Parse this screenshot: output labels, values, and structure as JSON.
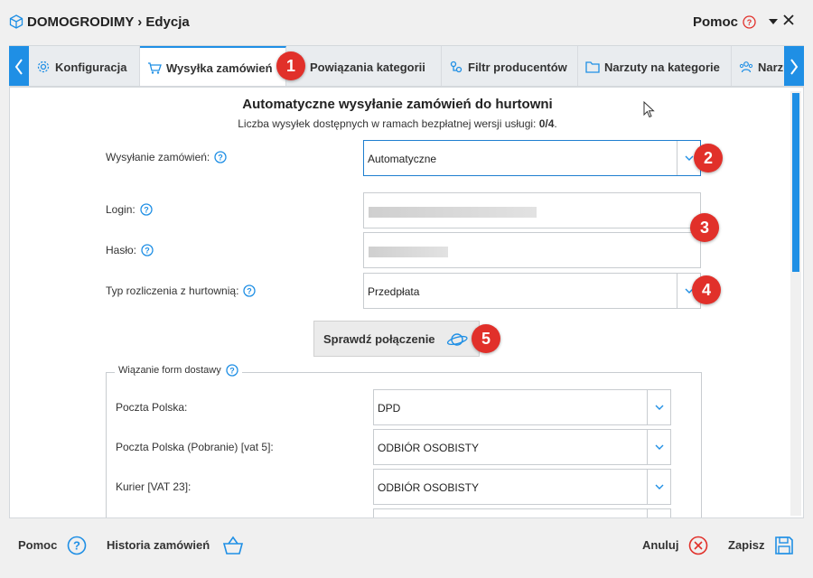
{
  "window": {
    "title": "DOMOGRODIMY › Edycja",
    "help_label": "Pomoc"
  },
  "tabs": [
    {
      "label": "Konfiguracja",
      "icon": "gear-icon"
    },
    {
      "label": "Wysyłka zamówień",
      "icon": "cart-icon",
      "active": true
    },
    {
      "label": "Powiązania kategorii",
      "icon": "link-icon"
    },
    {
      "label": "Filtr producentów",
      "icon": "filter-icon"
    },
    {
      "label": "Narzuty na kategorie",
      "icon": "folder-icon"
    },
    {
      "label": "Narzu",
      "icon": "users-icon"
    }
  ],
  "main": {
    "heading": "Automatyczne wysyłanie zamówień do hurtowni",
    "subheading_text": "Liczba wysyłek dostępnych w ramach bezpłatnej wersji usługi: ",
    "subheading_value": "0/4",
    "subheading_end": ".",
    "fields": {
      "order_sending": {
        "label": "Wysyłanie zamówień:",
        "value": "Automatyczne"
      },
      "login": {
        "label": "Login:"
      },
      "password": {
        "label": "Hasło:"
      },
      "billing_type": {
        "label": "Typ rozliczenia z hurtownią:",
        "value": "Przedpłata"
      }
    },
    "check_button": "Sprawdź połączenie",
    "shipping_mapping": {
      "legend": "Wiązanie form dostawy",
      "rows": [
        {
          "label": "Poczta Polska:",
          "value": "DPD"
        },
        {
          "label": "Poczta Polska (Pobranie) [vat 5]:",
          "value": "ODBIÓR OSOBISTY"
        },
        {
          "label": "Kurier [VAT 23]:",
          "value": "ODBIÓR OSOBISTY"
        }
      ]
    }
  },
  "badges": [
    "1",
    "2",
    "3",
    "4",
    "5"
  ],
  "footer": {
    "help": "Pomoc",
    "history": "Historia zamówień",
    "cancel": "Anuluj",
    "save": "Zapisz"
  },
  "colors": {
    "accent": "#1f8fe5",
    "badge": "#e1302a",
    "cancel": "#e1302a"
  }
}
